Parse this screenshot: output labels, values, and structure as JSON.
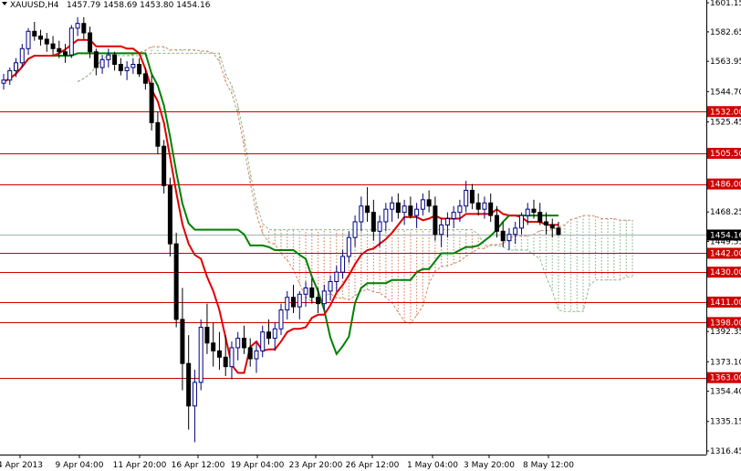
{
  "header": {
    "symbol": "XAUUSD,H4",
    "ohlc": "1457.79 1458.69 1453.80 1454.16"
  },
  "colors": {
    "background": "#ffffff",
    "bull_candle": "#000080",
    "bear_candle": "#000000",
    "tenkan": "#e00000",
    "kijun": "#008000",
    "cloud_bull": "#8db88d",
    "cloud_bear": "#d4896a",
    "hline": "#d00000",
    "price_line": "#a0b4b4",
    "price_tag_bg": "#000000",
    "level_tag_bg": "#d00000"
  },
  "chart_data": {
    "type": "candlestick",
    "ylim": [
      1316.45,
      1601.15
    ],
    "y_tick_labels": [
      "1601.15",
      "1582.65",
      "1563.95",
      "1544.70",
      "1525.45",
      "1505.50",
      "1486.00",
      "1468.25",
      "1449.55",
      "1430.00",
      "1411.00",
      "1392.35",
      "1373.10",
      "1354.40",
      "1335.15",
      "1316.45"
    ],
    "x_tick_labels": [
      "4 Apr 2013",
      "9 Apr 04:00",
      "11 Apr 20:00",
      "16 Apr 12:00",
      "19 Apr 04:00",
      "23 Apr 20:00",
      "26 Apr 12:00",
      "1 May 04:00",
      "3 May 20:00",
      "8 May 12:00"
    ],
    "horizontal_levels": [
      1532.0,
      1505.5,
      1486.0,
      1442.0,
      1430.0,
      1411.0,
      1398.0,
      1363.0
    ],
    "current_price": 1454.16,
    "price_bars": [
      [
        1550,
        1556,
        1546,
        1552
      ],
      [
        1552,
        1560,
        1549,
        1558
      ],
      [
        1558,
        1566,
        1554,
        1563
      ],
      [
        1563,
        1575,
        1560,
        1572
      ],
      [
        1572,
        1585,
        1568,
        1583
      ],
      [
        1583,
        1589,
        1577,
        1580
      ],
      [
        1580,
        1584,
        1574,
        1578
      ],
      [
        1578,
        1582,
        1570,
        1575
      ],
      [
        1575,
        1580,
        1568,
        1572
      ],
      [
        1572,
        1577,
        1566,
        1570
      ],
      [
        1570,
        1575,
        1563,
        1568
      ],
      [
        1568,
        1587,
        1566,
        1585
      ],
      [
        1585,
        1592,
        1580,
        1588
      ],
      [
        1588,
        1592,
        1578,
        1582
      ],
      [
        1582,
        1586,
        1566,
        1570
      ],
      [
        1570,
        1572,
        1555,
        1560
      ],
      [
        1560,
        1568,
        1556,
        1565
      ],
      [
        1565,
        1572,
        1560,
        1568
      ],
      [
        1568,
        1570,
        1558,
        1562
      ],
      [
        1562,
        1566,
        1555,
        1558
      ],
      [
        1558,
        1564,
        1552,
        1560
      ],
      [
        1560,
        1566,
        1556,
        1562
      ],
      [
        1562,
        1566,
        1554,
        1556
      ],
      [
        1556,
        1560,
        1546,
        1550
      ],
      [
        1550,
        1555,
        1520,
        1525
      ],
      [
        1525,
        1532,
        1505,
        1510
      ],
      [
        1510,
        1514,
        1480,
        1485
      ],
      [
        1485,
        1490,
        1440,
        1448
      ],
      [
        1448,
        1455,
        1395,
        1400
      ],
      [
        1400,
        1420,
        1355,
        1372
      ],
      [
        1372,
        1390,
        1330,
        1345
      ],
      [
        1345,
        1368,
        1322,
        1360
      ],
      [
        1360,
        1400,
        1355,
        1395
      ],
      [
        1395,
        1410,
        1378,
        1385
      ],
      [
        1385,
        1398,
        1370,
        1380
      ],
      [
        1380,
        1392,
        1368,
        1376
      ],
      [
        1376,
        1390,
        1364,
        1370
      ],
      [
        1370,
        1386,
        1362,
        1382
      ],
      [
        1382,
        1392,
        1374,
        1388
      ],
      [
        1388,
        1396,
        1378,
        1382
      ],
      [
        1382,
        1388,
        1370,
        1375
      ],
      [
        1375,
        1385,
        1366,
        1380
      ],
      [
        1380,
        1396,
        1376,
        1392
      ],
      [
        1392,
        1400,
        1384,
        1388
      ],
      [
        1388,
        1398,
        1380,
        1394
      ],
      [
        1394,
        1410,
        1390,
        1406
      ],
      [
        1406,
        1418,
        1400,
        1414
      ],
      [
        1414,
        1422,
        1404,
        1408
      ],
      [
        1408,
        1418,
        1400,
        1416
      ],
      [
        1416,
        1424,
        1408,
        1420
      ],
      [
        1420,
        1426,
        1410,
        1414
      ],
      [
        1414,
        1420,
        1404,
        1410
      ],
      [
        1410,
        1422,
        1406,
        1418
      ],
      [
        1418,
        1428,
        1412,
        1424
      ],
      [
        1424,
        1434,
        1418,
        1430
      ],
      [
        1430,
        1444,
        1426,
        1440
      ],
      [
        1440,
        1456,
        1436,
        1452
      ],
      [
        1452,
        1466,
        1446,
        1462
      ],
      [
        1462,
        1478,
        1456,
        1472
      ],
      [
        1472,
        1484,
        1462,
        1468
      ],
      [
        1468,
        1476,
        1450,
        1456
      ],
      [
        1456,
        1466,
        1446,
        1462
      ],
      [
        1462,
        1474,
        1456,
        1470
      ],
      [
        1470,
        1478,
        1462,
        1474
      ],
      [
        1474,
        1480,
        1464,
        1468
      ],
      [
        1468,
        1476,
        1460,
        1472
      ],
      [
        1472,
        1478,
        1464,
        1466
      ],
      [
        1466,
        1474,
        1458,
        1470
      ],
      [
        1470,
        1480,
        1466,
        1476
      ],
      [
        1476,
        1482,
        1468,
        1472
      ],
      [
        1472,
        1478,
        1450,
        1454
      ],
      [
        1454,
        1464,
        1446,
        1460
      ],
      [
        1460,
        1468,
        1452,
        1464
      ],
      [
        1464,
        1472,
        1458,
        1468
      ],
      [
        1468,
        1476,
        1462,
        1472
      ],
      [
        1472,
        1488,
        1468,
        1482
      ],
      [
        1482,
        1486,
        1470,
        1474
      ],
      [
        1474,
        1480,
        1466,
        1470
      ],
      [
        1470,
        1478,
        1464,
        1474
      ],
      [
        1474,
        1480,
        1462,
        1466
      ],
      [
        1466,
        1472,
        1452,
        1456
      ],
      [
        1456,
        1462,
        1446,
        1450
      ],
      [
        1450,
        1458,
        1444,
        1454
      ],
      [
        1454,
        1462,
        1448,
        1458
      ],
      [
        1458,
        1468,
        1454,
        1466
      ],
      [
        1466,
        1474,
        1460,
        1470
      ],
      [
        1470,
        1476,
        1464,
        1468
      ],
      [
        1468,
        1474,
        1460,
        1462
      ],
      [
        1462,
        1468,
        1454,
        1460
      ],
      [
        1460,
        1464,
        1452,
        1458
      ],
      [
        1458,
        1462,
        1453,
        1454
      ]
    ]
  }
}
